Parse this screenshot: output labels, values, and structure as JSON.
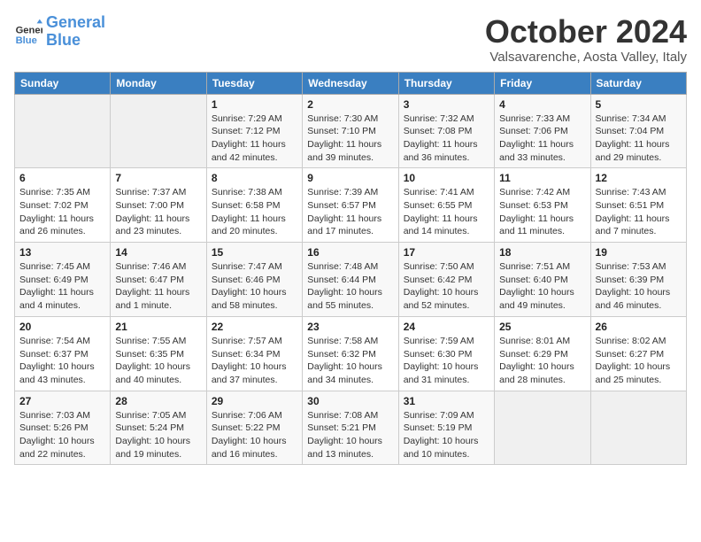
{
  "header": {
    "logo_line1": "General",
    "logo_line2": "Blue",
    "month": "October 2024",
    "location": "Valsavarenche, Aosta Valley, Italy"
  },
  "columns": [
    "Sunday",
    "Monday",
    "Tuesday",
    "Wednesday",
    "Thursday",
    "Friday",
    "Saturday"
  ],
  "weeks": [
    [
      {
        "day": "",
        "info": ""
      },
      {
        "day": "",
        "info": ""
      },
      {
        "day": "1",
        "info": "Sunrise: 7:29 AM\nSunset: 7:12 PM\nDaylight: 11 hours and 42 minutes."
      },
      {
        "day": "2",
        "info": "Sunrise: 7:30 AM\nSunset: 7:10 PM\nDaylight: 11 hours and 39 minutes."
      },
      {
        "day": "3",
        "info": "Sunrise: 7:32 AM\nSunset: 7:08 PM\nDaylight: 11 hours and 36 minutes."
      },
      {
        "day": "4",
        "info": "Sunrise: 7:33 AM\nSunset: 7:06 PM\nDaylight: 11 hours and 33 minutes."
      },
      {
        "day": "5",
        "info": "Sunrise: 7:34 AM\nSunset: 7:04 PM\nDaylight: 11 hours and 29 minutes."
      }
    ],
    [
      {
        "day": "6",
        "info": "Sunrise: 7:35 AM\nSunset: 7:02 PM\nDaylight: 11 hours and 26 minutes."
      },
      {
        "day": "7",
        "info": "Sunrise: 7:37 AM\nSunset: 7:00 PM\nDaylight: 11 hours and 23 minutes."
      },
      {
        "day": "8",
        "info": "Sunrise: 7:38 AM\nSunset: 6:58 PM\nDaylight: 11 hours and 20 minutes."
      },
      {
        "day": "9",
        "info": "Sunrise: 7:39 AM\nSunset: 6:57 PM\nDaylight: 11 hours and 17 minutes."
      },
      {
        "day": "10",
        "info": "Sunrise: 7:41 AM\nSunset: 6:55 PM\nDaylight: 11 hours and 14 minutes."
      },
      {
        "day": "11",
        "info": "Sunrise: 7:42 AM\nSunset: 6:53 PM\nDaylight: 11 hours and 11 minutes."
      },
      {
        "day": "12",
        "info": "Sunrise: 7:43 AM\nSunset: 6:51 PM\nDaylight: 11 hours and 7 minutes."
      }
    ],
    [
      {
        "day": "13",
        "info": "Sunrise: 7:45 AM\nSunset: 6:49 PM\nDaylight: 11 hours and 4 minutes."
      },
      {
        "day": "14",
        "info": "Sunrise: 7:46 AM\nSunset: 6:47 PM\nDaylight: 11 hours and 1 minute."
      },
      {
        "day": "15",
        "info": "Sunrise: 7:47 AM\nSunset: 6:46 PM\nDaylight: 10 hours and 58 minutes."
      },
      {
        "day": "16",
        "info": "Sunrise: 7:48 AM\nSunset: 6:44 PM\nDaylight: 10 hours and 55 minutes."
      },
      {
        "day": "17",
        "info": "Sunrise: 7:50 AM\nSunset: 6:42 PM\nDaylight: 10 hours and 52 minutes."
      },
      {
        "day": "18",
        "info": "Sunrise: 7:51 AM\nSunset: 6:40 PM\nDaylight: 10 hours and 49 minutes."
      },
      {
        "day": "19",
        "info": "Sunrise: 7:53 AM\nSunset: 6:39 PM\nDaylight: 10 hours and 46 minutes."
      }
    ],
    [
      {
        "day": "20",
        "info": "Sunrise: 7:54 AM\nSunset: 6:37 PM\nDaylight: 10 hours and 43 minutes."
      },
      {
        "day": "21",
        "info": "Sunrise: 7:55 AM\nSunset: 6:35 PM\nDaylight: 10 hours and 40 minutes."
      },
      {
        "day": "22",
        "info": "Sunrise: 7:57 AM\nSunset: 6:34 PM\nDaylight: 10 hours and 37 minutes."
      },
      {
        "day": "23",
        "info": "Sunrise: 7:58 AM\nSunset: 6:32 PM\nDaylight: 10 hours and 34 minutes."
      },
      {
        "day": "24",
        "info": "Sunrise: 7:59 AM\nSunset: 6:30 PM\nDaylight: 10 hours and 31 minutes."
      },
      {
        "day": "25",
        "info": "Sunrise: 8:01 AM\nSunset: 6:29 PM\nDaylight: 10 hours and 28 minutes."
      },
      {
        "day": "26",
        "info": "Sunrise: 8:02 AM\nSunset: 6:27 PM\nDaylight: 10 hours and 25 minutes."
      }
    ],
    [
      {
        "day": "27",
        "info": "Sunrise: 7:03 AM\nSunset: 5:26 PM\nDaylight: 10 hours and 22 minutes."
      },
      {
        "day": "28",
        "info": "Sunrise: 7:05 AM\nSunset: 5:24 PM\nDaylight: 10 hours and 19 minutes."
      },
      {
        "day": "29",
        "info": "Sunrise: 7:06 AM\nSunset: 5:22 PM\nDaylight: 10 hours and 16 minutes."
      },
      {
        "day": "30",
        "info": "Sunrise: 7:08 AM\nSunset: 5:21 PM\nDaylight: 10 hours and 13 minutes."
      },
      {
        "day": "31",
        "info": "Sunrise: 7:09 AM\nSunset: 5:19 PM\nDaylight: 10 hours and 10 minutes."
      },
      {
        "day": "",
        "info": ""
      },
      {
        "day": "",
        "info": ""
      }
    ]
  ]
}
